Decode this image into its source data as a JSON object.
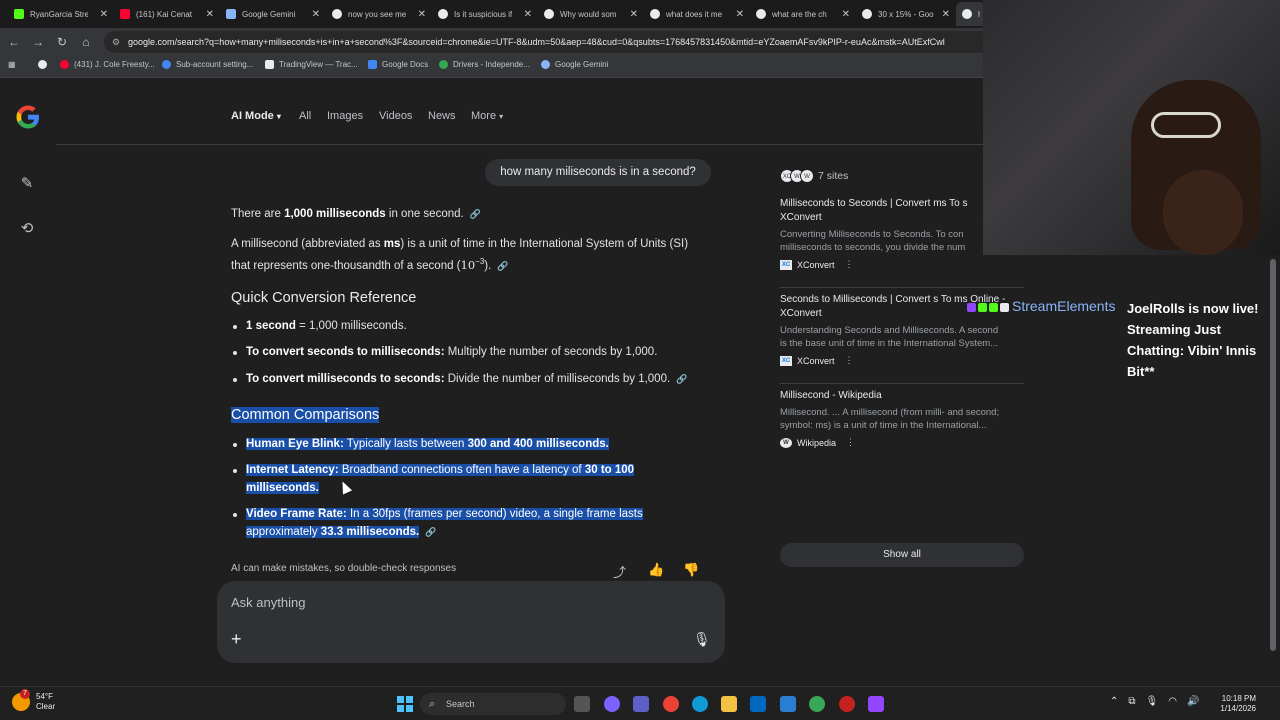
{
  "tabs": [
    {
      "label": "RyanGarcia Strea",
      "color": "#53fc18"
    },
    {
      "label": "(161) Kai Cenat",
      "color": "#ff0033"
    },
    {
      "label": "Google Gemini",
      "color": "#8ab4f8"
    },
    {
      "label": "now you see me",
      "color": "#e8eaed"
    },
    {
      "label": "Is it suspicious if",
      "color": "#e8eaed"
    },
    {
      "label": "Why would som",
      "color": "#e8eaed"
    },
    {
      "label": "what does it me",
      "color": "#e8eaed"
    },
    {
      "label": "what are the ch",
      "color": "#e8eaed"
    },
    {
      "label": "30 x 15% - Goo",
      "color": "#e8eaed"
    },
    {
      "label": "h",
      "color": "#e8eaed"
    }
  ],
  "omnibox": {
    "url": "google.com/search?q=how+many+miliseconds+is+in+a+second%3F&sourceid=chrome&ie=UTF-8&udm=50&aep=48&cud=0&qsubts=1768457831450&mtid=eYZoaemAFsv9kPIP-r-euAc&mstk=AUtExfCwl"
  },
  "bookmarks": [
    {
      "label": "(431) J. Cole Freesty...",
      "color": "#ff0033"
    },
    {
      "label": "Sub-account setting...",
      "color": "#4285f4"
    },
    {
      "label": "TradingView — Trac...",
      "color": "#e8eaed"
    },
    {
      "label": "Google Docs",
      "color": "#4285f4"
    },
    {
      "label": "Drivers - Independe...",
      "color": "#34a853"
    },
    {
      "label": "Google Gemini",
      "color": "#8ab4f8"
    }
  ],
  "nav": {
    "ai_mode": "AI Mode",
    "all": "All",
    "images": "Images",
    "videos": "Videos",
    "news": "News",
    "more": "More"
  },
  "conversation": {
    "user_query": "how many miliseconds is in a second?",
    "answer_pre": "There are ",
    "answer_bold": "1,000 milliseconds",
    "answer_post": " in one second.",
    "def_line1_a": "A millisecond (abbreviated as ",
    "def_line1_b": "ms",
    "def_line1_c": ") is a unit of time in the International System of Units (SI)",
    "def_line2_a": "that represents one-thousandth of a second (",
    "def_line2_formula": "10",
    "def_line2_exp": "−3",
    "def_line2_c": ").",
    "quick_heading": "Quick Conversion Reference",
    "quick_items": [
      {
        "bold": "1 second",
        "text": " = 1,000 milliseconds."
      },
      {
        "bold": "To convert seconds to milliseconds:",
        "text": " Multiply the number of seconds by 1,000."
      },
      {
        "bold": "To convert milliseconds to seconds:",
        "text": " Divide the number of milliseconds by 1,000."
      }
    ],
    "common_heading": "Common Comparisons",
    "common_1_bold": "Human Eye Blink:",
    "common_1_text": " Typically lasts between ",
    "common_1_bold2": "300 and 400 milliseconds.",
    "common_2_bold": "Internet Latency:",
    "common_2_text": " Broadband connections often have a latency of ",
    "common_2_bold2": "30 to 100",
    "common_2_bold3": "milliseconds.",
    "common_3_bold": "Video Frame Rate:",
    "common_3_text": " In a 30fps (frames per second) video, a single frame lasts",
    "common_3_text2": "approximately ",
    "common_3_bold2": "33.3 milliseconds.",
    "disclaimer": "AI can make mistakes, so double-check responses"
  },
  "ask": {
    "placeholder": "Ask anything"
  },
  "sources": {
    "count_label": "7 sites",
    "items": [
      {
        "title_1": "Milliseconds to Seconds | Convert ms To s",
        "title_2": "XConvert",
        "snippet_1": "Converting Milliseconds to Seconds. To con",
        "snippet_2": "milliseconds to seconds, you divide the num",
        "site": "XConvert",
        "site_icon": "XC"
      },
      {
        "title_1": "Seconds to Milliseconds | Convert s To ms Online -",
        "title_2": "XConvert",
        "snippet_1": "Understanding Seconds and Milliseconds. A second",
        "snippet_2": "is the base unit of time in the International System...",
        "site": "XConvert",
        "site_icon": "XC"
      },
      {
        "title_1": "Millisecond - Wikipedia",
        "title_2": "",
        "snippet_1": "Millisecond. ... A millisecond (from milli- and second;",
        "snippet_2": "symbol: ms) is a unit of time in the International...",
        "site": "Wikipedia",
        "site_icon": "W"
      }
    ],
    "show_all": "Show all"
  },
  "stream_alert": {
    "source": "StreamElements",
    "message": "JoelRolls is now live! Streaming Just Chatting: Vibin' Innis Bit**"
  },
  "taskbar": {
    "temp": "54°F",
    "condition": "Clear",
    "badge": "7",
    "search": "Search",
    "time": "10:18 PM",
    "date": "1/14/2026"
  }
}
